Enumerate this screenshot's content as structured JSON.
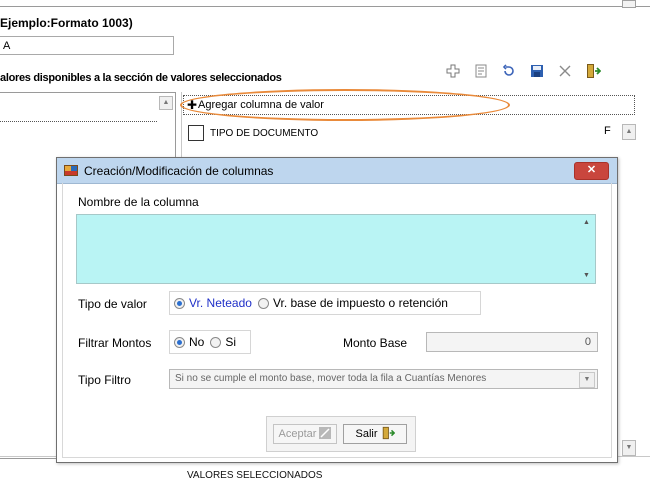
{
  "background": {
    "example_title": "Ejemplo:Formato 1003)",
    "format_value": "A",
    "section_title": "alores disponibles a la sección de valores seleccionados",
    "toolbar_icons": [
      "plus-icon",
      "edit-icon",
      "undo-icon",
      "save-icon",
      "close-icon",
      "exit-icon"
    ],
    "add_column_label": "Agregar columna de valor",
    "tipo_documento_label": "TIPO DE DOCUMENTO",
    "row_suffix": "F",
    "bottom_label": "VALORES SELECCIONADOS"
  },
  "dialog": {
    "title": "Creación/Modificación de columnas",
    "close_label": "✕",
    "nombre_label": "Nombre de la columna",
    "nombre_value": "",
    "tipo_valor_label": "Tipo de valor",
    "tipo_valor_options": [
      "Vr. Neteado",
      "Vr. base de impuesto o retención"
    ],
    "tipo_valor_selected": "Vr. Neteado",
    "filtrar_montos_label": "Filtrar Montos",
    "filtrar_options": [
      "No",
      "Si"
    ],
    "filtrar_selected": "No",
    "monto_base_label": "Monto Base",
    "monto_base_value": "0",
    "tipo_filtro_label": "Tipo Filtro",
    "tipo_filtro_value": "Si no se cumple el monto base, mover toda la fila a Cuantías Menores",
    "aceptar_label": "Aceptar",
    "salir_label": "Salir"
  },
  "colors": {
    "highlight_oval": "#e98a3a",
    "titlebar": "#bed6ee",
    "close_button": "#c9463d",
    "textarea_bg": "#b9f4f4",
    "selected_radio_text": "#2030c8"
  }
}
